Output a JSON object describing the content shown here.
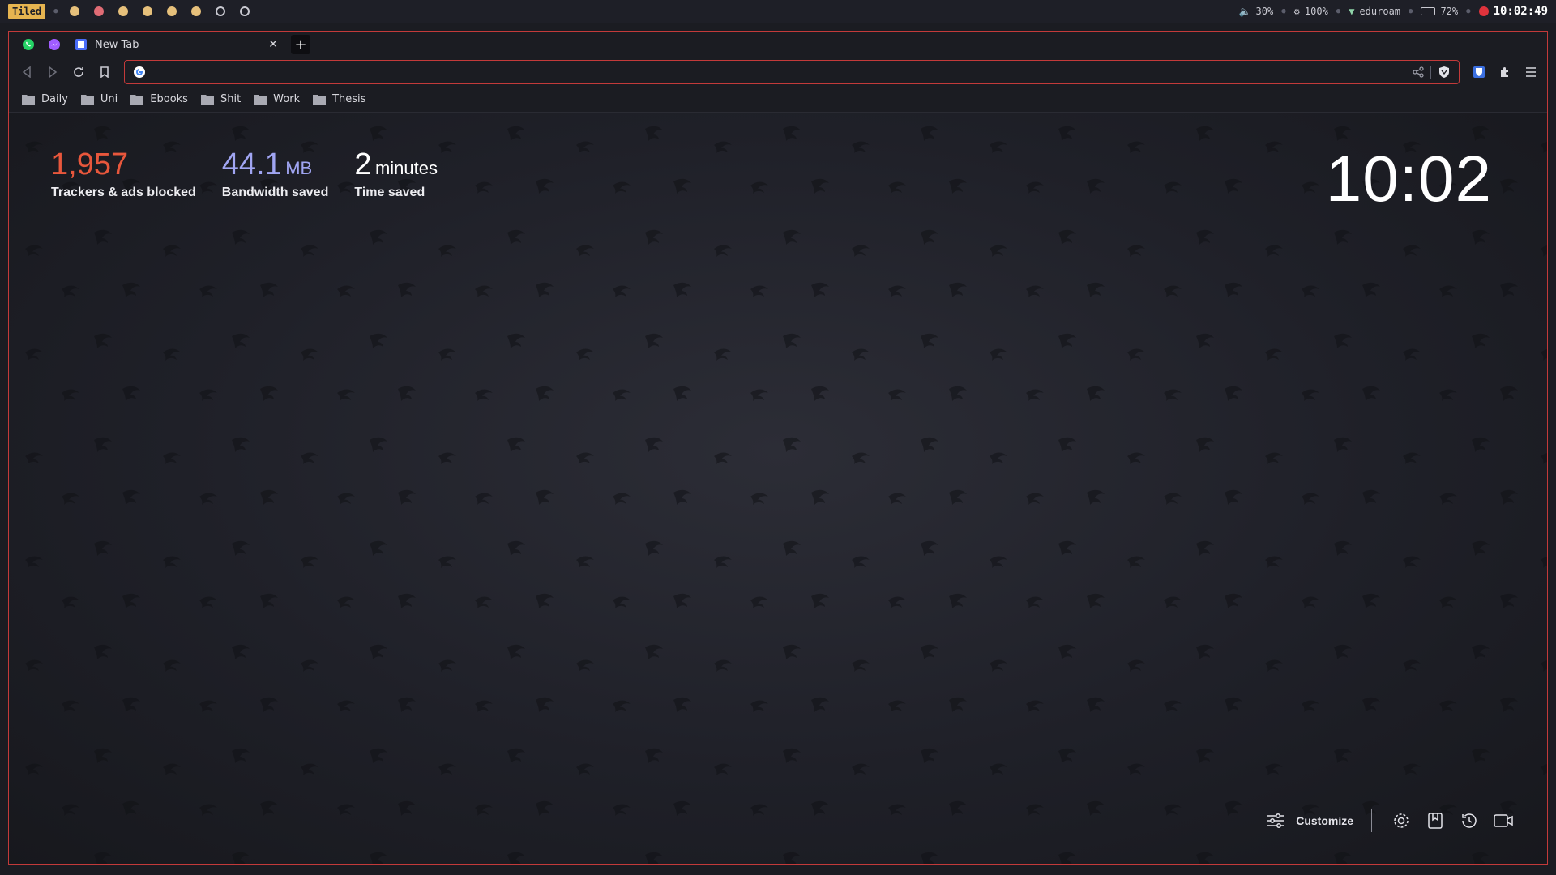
{
  "statusbar": {
    "layout": "Tiled",
    "workspaces": [
      "full",
      "urgent",
      "full",
      "full",
      "full",
      "full",
      "empty",
      "empty"
    ],
    "volume": "30%",
    "brightness": "100%",
    "network": "eduroam",
    "battery": "72%",
    "clock": "10:02:49"
  },
  "tabs": {
    "active_title": "New Tab"
  },
  "urlbar": {
    "value": ""
  },
  "bookmarks": [
    "Daily",
    "Uni",
    "Ebooks",
    "Shit",
    "Work",
    "Thesis"
  ],
  "stats": {
    "trackers_value": "1,957",
    "trackers_label": "Trackers & ads blocked",
    "bandwidth_value": "44.1",
    "bandwidth_unit": "MB",
    "bandwidth_label": "Bandwidth saved",
    "time_value": "2",
    "time_unit": "minutes",
    "time_label": "Time saved"
  },
  "clock": "10:02",
  "footer": {
    "customize_label": "Customize"
  },
  "colors": {
    "accent_red": "#c33a3a",
    "trackers": "#e8573c",
    "bandwidth": "#a0a5f2"
  }
}
